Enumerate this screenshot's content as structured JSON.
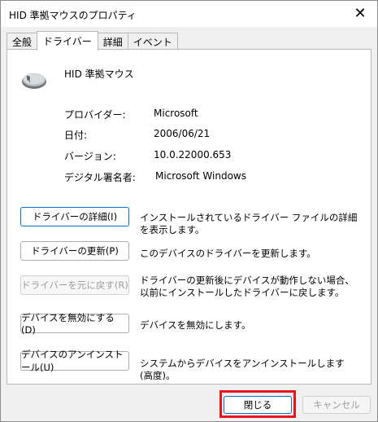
{
  "window": {
    "title": "HID 準拠マウスのプロパティ",
    "close_glyph": "✕"
  },
  "tabs": [
    {
      "label": "全般",
      "active": false
    },
    {
      "label": "ドライバー",
      "active": true
    },
    {
      "label": "詳細",
      "active": false
    },
    {
      "label": "イベント",
      "active": false
    }
  ],
  "device": {
    "icon": "mouse-icon",
    "name": "HID 準拠マウス"
  },
  "info": {
    "provider_label": "プロバイダー:",
    "provider_value": "Microsoft",
    "date_label": "日付:",
    "date_value": "2006/06/21",
    "version_label": "バージョン:",
    "version_value": "10.0.22000.653",
    "signer_label": "デジタル署名者:",
    "signer_value": "Microsoft Windows"
  },
  "actions": [
    {
      "label": "ドライバーの詳細(I)",
      "desc": "インストールされているドライバー ファイルの詳細を表示します。",
      "enabled": true
    },
    {
      "label": "ドライバーの更新(P)",
      "desc": "このデバイスのドライバーを更新します。",
      "enabled": true
    },
    {
      "label": "ドライバーを元に戻す(R)",
      "desc": "ドライバーの更新後にデバイスが動作しない場合、以前にインストールしたドライバーに戻します。",
      "enabled": false
    },
    {
      "label": "デバイスを無効にする(D)",
      "desc": "デバイスを無効にします。",
      "enabled": true
    },
    {
      "label": "デバイスのアンインストール(U)",
      "desc": "システムからデバイスをアンインストールします (高度)。",
      "enabled": true
    }
  ],
  "footer": {
    "close_label": "閉じる",
    "cancel_label": "キャンセル"
  },
  "colors": {
    "highlight": "#e8141e",
    "accent": "#0a6ec8"
  }
}
